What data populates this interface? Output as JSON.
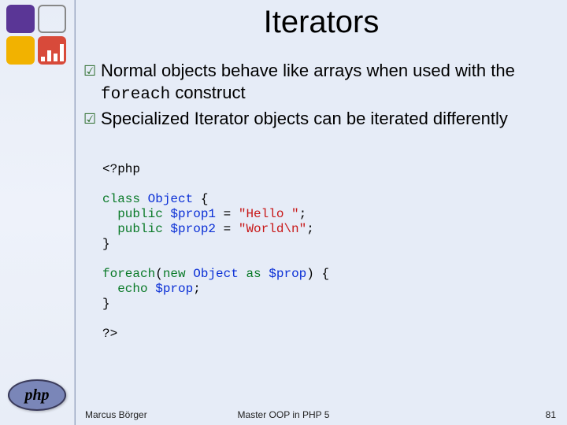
{
  "title": "Iterators",
  "bullets": {
    "b1_pre": "Normal objects behave like arrays when used with the ",
    "b1_code": "foreach",
    "b1_post": " construct",
    "b2": "Specialized Iterator objects can be iterated differently"
  },
  "code": {
    "open": "<?php",
    "l1a": "class ",
    "l1b": "Object ",
    "l1c": "{",
    "l2a": "  public ",
    "l2b": "$prop1 ",
    "l2c": "= ",
    "l2d": "\"Hello \"",
    "l2e": ";",
    "l3a": "  public ",
    "l3b": "$prop2 ",
    "l3c": "= ",
    "l3d": "\"World\\n\"",
    "l3e": ";",
    "l4": "}",
    "l5a": "foreach",
    "l5b": "(",
    "l5c": "new ",
    "l5d": "Object ",
    "l5e": "as ",
    "l5f": "$prop",
    "l5g": ") {",
    "l6a": "  echo ",
    "l6b": "$prop",
    "l6c": ";",
    "l7": "}",
    "close": "?>"
  },
  "footer": {
    "author": "Marcus Börger",
    "center": "Master OOP in PHP 5",
    "page": "81"
  },
  "php_logo_text": "php"
}
